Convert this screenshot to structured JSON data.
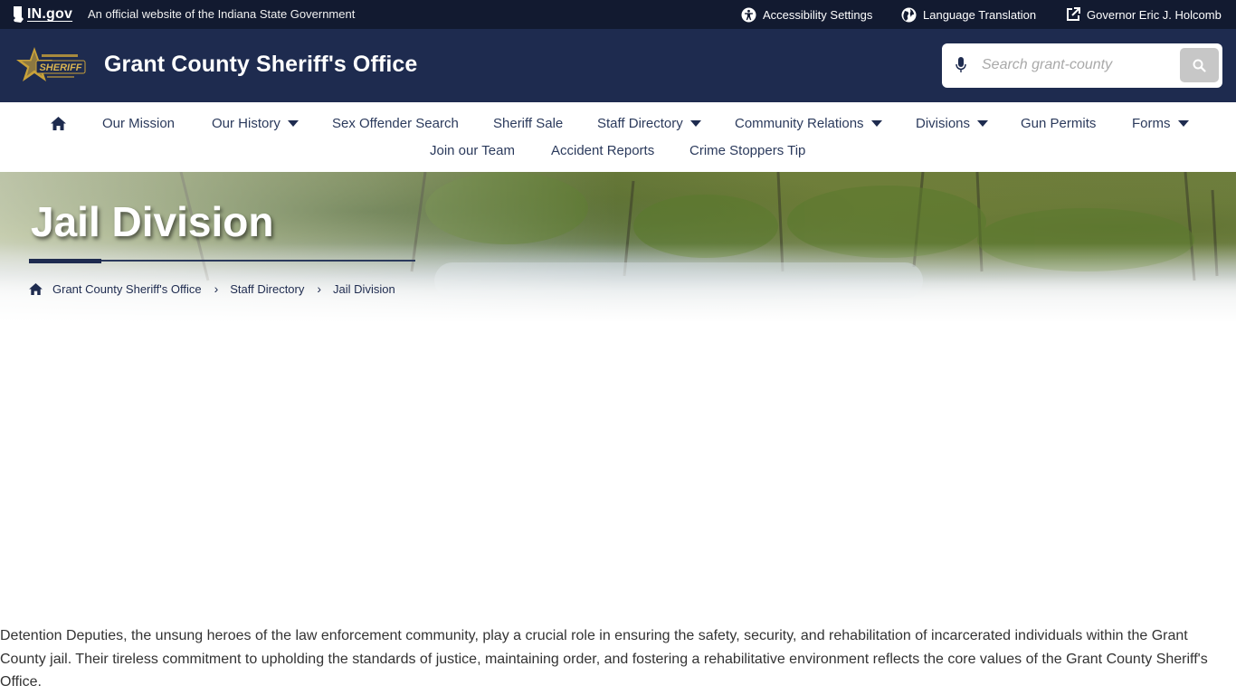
{
  "govbar": {
    "brand": "IN.gov",
    "official_text": "An official website of the Indiana State Government",
    "links": [
      {
        "label": "Accessibility Settings",
        "icon": "accessibility-icon"
      },
      {
        "label": "Language Translation",
        "icon": "globe-icon"
      },
      {
        "label": "Governor Eric J. Holcomb",
        "icon": "external-link-icon"
      }
    ]
  },
  "header": {
    "title": "Grant County Sheriff's Office",
    "logo_icon": "sheriff-star-logo",
    "search": {
      "placeholder": "Search grant-county",
      "value": ""
    }
  },
  "nav": {
    "items": [
      {
        "label": "Our Mission"
      },
      {
        "label": "Our History",
        "has_dropdown": true
      },
      {
        "label": "Sex Offender Search"
      },
      {
        "label": "Sheriff Sale"
      },
      {
        "label": "Staff Directory",
        "has_dropdown": true
      },
      {
        "label": "Community Relations",
        "has_dropdown": true
      },
      {
        "label": "Divisions",
        "has_dropdown": true
      },
      {
        "label": "Gun Permits"
      },
      {
        "label": "Forms",
        "has_dropdown": true
      },
      {
        "label": "Join our Team"
      },
      {
        "label": "Accident Reports"
      },
      {
        "label": "Crime Stoppers Tip"
      }
    ]
  },
  "hero": {
    "title": "Jail Division",
    "breadcrumb": [
      "Grant County Sheriff's Office",
      "Staff Directory",
      "Jail Division"
    ]
  },
  "content": {
    "paragraph": "Detention Deputies, the unsung heroes of the law enforcement community, play a crucial role in ensuring the safety, security, and rehabilitation of incarcerated individuals within the Grant County jail. Their tireless commitment to upholding the standards of justice, maintaining order, and fostering a rehabilitative environment reflects the core values of the Grant County Sheriff's Office."
  },
  "colors": {
    "govbar_bg": "#121a30",
    "header_bg": "#1e2b4f",
    "nav_text": "#2b3a5c"
  }
}
